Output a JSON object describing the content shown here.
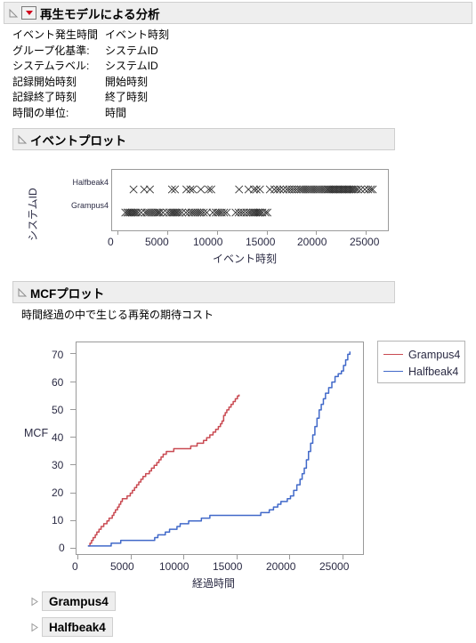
{
  "window": {
    "title": "再生モデルによる分析"
  },
  "spec": {
    "rows": [
      {
        "key": "イベント発生時間",
        "value": "イベント時刻"
      },
      {
        "key": "グループ化基準:",
        "value": "システムID"
      },
      {
        "key": "システムラベル:",
        "value": "システムID"
      },
      {
        "key": "記録開始時刻",
        "value": "開始時刻"
      },
      {
        "key": "記録終了時刻",
        "value": "終了時刻"
      },
      {
        "key": "時間の単位:",
        "value": "時間"
      }
    ]
  },
  "event_plot": {
    "title": "イベントプロット",
    "ylabel": "システムID",
    "xlabel": "イベント時刻",
    "categories": [
      "Halfbeak4",
      "Grampus4"
    ],
    "xticks": [
      "0",
      "5000",
      "10000",
      "15000",
      "20000",
      "25000"
    ]
  },
  "mcf_plot": {
    "title": "MCFプロット",
    "subtitle": "時間経過の中で生じる再発の期待コスト",
    "ylabel": "MCF",
    "xlabel": "経過時間",
    "xticks": [
      "0",
      "5000",
      "10000",
      "15000",
      "20000",
      "25000"
    ],
    "yticks": [
      "0",
      "10",
      "20",
      "30",
      "40",
      "50",
      "60",
      "70"
    ],
    "legend": [
      {
        "label": "Grampus4",
        "color": "#c94a52"
      },
      {
        "label": "Halfbeak4",
        "color": "#4169c9"
      }
    ]
  },
  "bottom_sections": [
    {
      "title": "Grampus4"
    },
    {
      "title": "Halfbeak4"
    }
  ],
  "colors": {
    "grampus": "#c94a52",
    "halfbeak": "#4169c9",
    "bar_bg": "#eeeeee",
    "bar_border": "#cfcfcf",
    "axis": "#9a9a9a",
    "text": "#2b2b44",
    "red_button": "#d0021b"
  },
  "chart_data": [
    {
      "type": "scatter",
      "name": "event-plot",
      "title": "イベントプロット",
      "xlabel": "イベント時刻",
      "ylabel": "システムID",
      "xlim": [
        0,
        26500
      ],
      "categories": [
        "Halfbeak4",
        "Grampus4"
      ],
      "grid": false,
      "series": [
        {
          "name": "Halfbeak4",
          "x": [
            1530,
            2600,
            3180,
            5400,
            5700,
            6850,
            7250,
            7500,
            8300,
            9100,
            9350,
            12150,
            13100,
            13650,
            13900,
            14250,
            15250,
            15700,
            16000,
            16250,
            16600,
            16950,
            17200,
            17450,
            17700,
            17950,
            18200,
            18400,
            18600,
            18800,
            19000,
            19200,
            19400,
            19600,
            19800,
            20000,
            20200,
            20400,
            20600,
            20800,
            21000,
            21150,
            21300,
            21450,
            21600,
            21750,
            21900,
            22050,
            22200,
            22350,
            22500,
            22650,
            22800,
            22950,
            23100,
            23250,
            23400,
            23550,
            23700,
            23900,
            24100,
            24400,
            24800,
            25150,
            25400,
            25600
          ]
        },
        {
          "name": "Grampus4",
          "x": [
            700,
            900,
            1050,
            1200,
            1350,
            1500,
            1650,
            1800,
            2000,
            2300,
            2700,
            2900,
            3100,
            3300,
            3500,
            3700,
            3900,
            4050,
            4200,
            4500,
            4900,
            5150,
            5350,
            5500,
            5650,
            5800,
            5950,
            6150,
            6400,
            6800,
            7100,
            7350,
            7550,
            7750,
            7950,
            8150,
            8350,
            8600,
            8900,
            9500,
            9800,
            10000,
            10200,
            10400,
            10650,
            10900,
            11800,
            12100,
            12350,
            12600,
            12900,
            13150,
            13350,
            13550,
            13700,
            13850,
            14000,
            14150,
            14300,
            14500,
            14800,
            15000
          ]
        }
      ]
    },
    {
      "type": "line",
      "name": "mcf-plot",
      "title": "MCFプロット",
      "subtitle": "時間経過の中で生じる再発の期待コスト",
      "xlabel": "経過時間",
      "ylabel": "MCF",
      "xlim": [
        0,
        26500
      ],
      "ylim": [
        0,
        73
      ],
      "grid": false,
      "legend_position": "right",
      "step": true,
      "series": [
        {
          "name": "Grampus4",
          "color": "#c94a52",
          "points": [
            [
              950,
              1
            ],
            [
              1100,
              2
            ],
            [
              1250,
              3
            ],
            [
              1400,
              4
            ],
            [
              1600,
              5
            ],
            [
              1750,
              6
            ],
            [
              1950,
              7
            ],
            [
              2150,
              8
            ],
            [
              2400,
              9
            ],
            [
              2700,
              10
            ],
            [
              2900,
              11
            ],
            [
              3050,
              11
            ],
            [
              3200,
              12
            ],
            [
              3350,
              13
            ],
            [
              3500,
              14
            ],
            [
              3700,
              15
            ],
            [
              3850,
              16
            ],
            [
              4000,
              17
            ],
            [
              4150,
              18
            ],
            [
              4300,
              18
            ],
            [
              4600,
              19
            ],
            [
              4900,
              20
            ],
            [
              5100,
              21
            ],
            [
              5300,
              22
            ],
            [
              5500,
              23
            ],
            [
              5700,
              24
            ],
            [
              5900,
              25
            ],
            [
              6100,
              26
            ],
            [
              6350,
              27
            ],
            [
              6500,
              27
            ],
            [
              6700,
              28
            ],
            [
              6900,
              29
            ],
            [
              7150,
              30
            ],
            [
              7400,
              31
            ],
            [
              7600,
              32
            ],
            [
              7800,
              33
            ],
            [
              8000,
              34
            ],
            [
              8300,
              35
            ],
            [
              8600,
              35
            ],
            [
              9000,
              36
            ],
            [
              9600,
              36
            ],
            [
              10100,
              36
            ],
            [
              10600,
              37
            ],
            [
              10900,
              37
            ],
            [
              11200,
              38
            ],
            [
              11500,
              38
            ],
            [
              11800,
              39
            ],
            [
              12100,
              40
            ],
            [
              12400,
              41
            ],
            [
              12700,
              42
            ],
            [
              12950,
              43
            ],
            [
              13200,
              44
            ],
            [
              13400,
              45
            ],
            [
              13550,
              46
            ],
            [
              13700,
              48
            ],
            [
              13850,
              49
            ],
            [
              14000,
              50
            ],
            [
              14200,
              51
            ],
            [
              14400,
              52
            ],
            [
              14600,
              53
            ],
            [
              14800,
              54
            ],
            [
              15000,
              55
            ],
            [
              15150,
              55.5
            ]
          ]
        },
        {
          "name": "Halfbeak4",
          "color": "#4169c9",
          "points": [
            [
              900,
              1
            ],
            [
              1500,
              1
            ],
            [
              2000,
              1
            ],
            [
              2600,
              1
            ],
            [
              3000,
              1
            ],
            [
              3100,
              2
            ],
            [
              3600,
              2
            ],
            [
              4000,
              3
            ],
            [
              4500,
              3
            ],
            [
              5000,
              3
            ],
            [
              5500,
              3
            ],
            [
              6000,
              3
            ],
            [
              6500,
              3
            ],
            [
              7000,
              3
            ],
            [
              7200,
              4
            ],
            [
              7500,
              5
            ],
            [
              7800,
              5
            ],
            [
              8200,
              6
            ],
            [
              8600,
              7
            ],
            [
              9000,
              7
            ],
            [
              9300,
              8
            ],
            [
              9600,
              9
            ],
            [
              10000,
              9
            ],
            [
              10400,
              10
            ],
            [
              10800,
              10
            ],
            [
              11200,
              10
            ],
            [
              11600,
              11
            ],
            [
              12000,
              11
            ],
            [
              12400,
              12
            ],
            [
              13000,
              12
            ],
            [
              14000,
              12
            ],
            [
              15000,
              12
            ],
            [
              16000,
              12
            ],
            [
              16800,
              12
            ],
            [
              17200,
              13
            ],
            [
              17600,
              13
            ],
            [
              18000,
              14
            ],
            [
              18400,
              15
            ],
            [
              18800,
              16
            ],
            [
              19100,
              17
            ],
            [
              19400,
              17
            ],
            [
              19700,
              18
            ],
            [
              20000,
              19
            ],
            [
              20300,
              21
            ],
            [
              20600,
              23
            ],
            [
              20900,
              25
            ],
            [
              21100,
              27
            ],
            [
              21300,
              29
            ],
            [
              21500,
              32
            ],
            [
              21700,
              35
            ],
            [
              21900,
              38
            ],
            [
              22100,
              41
            ],
            [
              22300,
              44
            ],
            [
              22500,
              47
            ],
            [
              22700,
              50
            ],
            [
              22900,
              52
            ],
            [
              23100,
              54
            ],
            [
              23300,
              56
            ],
            [
              23600,
              58
            ],
            [
              23900,
              60
            ],
            [
              24200,
              62
            ],
            [
              24500,
              63
            ],
            [
              24800,
              64
            ],
            [
              25000,
              66
            ],
            [
              25200,
              68
            ],
            [
              25400,
              70
            ],
            [
              25600,
              71
            ]
          ]
        }
      ]
    }
  ]
}
